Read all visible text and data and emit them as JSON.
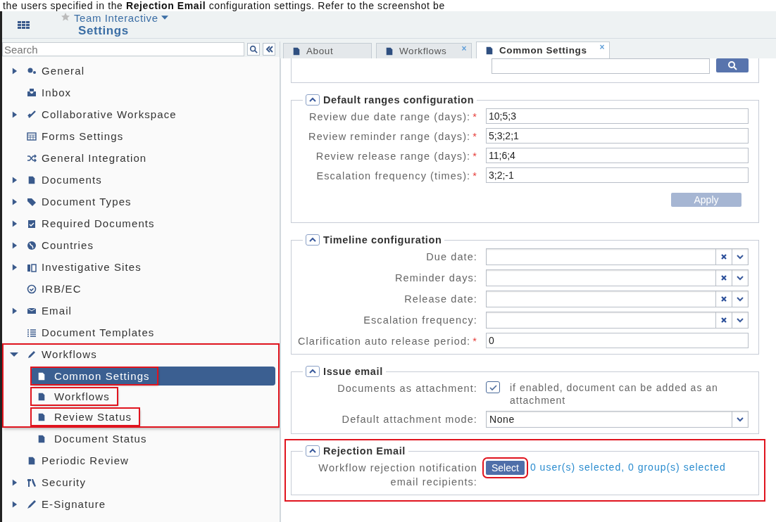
{
  "caption": "the users specified in the **Rejection Email** configuration settings. Refer to the screenshot be",
  "header": {
    "workspace": "Team Interactive",
    "title": "Settings",
    "favorite": false
  },
  "search": {
    "placeholder": "Search"
  },
  "tree": [
    {
      "label": "General",
      "expandable": true,
      "expanded": false
    },
    {
      "label": "Inbox",
      "expandable": false
    },
    {
      "label": "Collaborative Workspace",
      "expandable": true,
      "expanded": false
    },
    {
      "label": "Forms Settings",
      "expandable": false
    },
    {
      "label": "General Integration",
      "expandable": false
    },
    {
      "label": "Documents",
      "expandable": true,
      "expanded": false
    },
    {
      "label": "Document Types",
      "expandable": true,
      "expanded": false
    },
    {
      "label": "Required Documents",
      "expandable": true,
      "expanded": false
    },
    {
      "label": "Countries",
      "expandable": true,
      "expanded": false
    },
    {
      "label": "Investigative Sites",
      "expandable": true,
      "expanded": false
    },
    {
      "label": "IRB/EC",
      "expandable": false
    },
    {
      "label": "Email",
      "expandable": true,
      "expanded": false
    },
    {
      "label": "Document Templates",
      "expandable": false
    },
    {
      "label": "Workflows",
      "expandable": true,
      "expanded": true,
      "highlighted": true,
      "children": [
        {
          "label": "Common Settings",
          "selected": true,
          "highlighted": true
        },
        {
          "label": "Workflows",
          "selected": false,
          "highlighted": true
        },
        {
          "label": "Review Status",
          "selected": false,
          "highlighted": true
        },
        {
          "label": "Document Status",
          "selected": false,
          "highlighted": false
        }
      ]
    },
    {
      "label": "Periodic Review",
      "expandable": false
    },
    {
      "label": "Security",
      "expandable": true,
      "expanded": false
    },
    {
      "label": "E-Signature",
      "expandable": true,
      "expanded": false
    }
  ],
  "tabs": [
    {
      "label": "About",
      "selected": false
    },
    {
      "label": "Workflows",
      "selected": false,
      "close": "×"
    },
    {
      "label": "Common Settings",
      "selected": true,
      "close": "×"
    }
  ],
  "sections": [
    {
      "fields": [
        {
          "kind": "search"
        }
      ]
    },
    {
      "title": "Default ranges configuration",
      "expanded": true,
      "highlighted": false,
      "fields": [
        {
          "kind": "text",
          "label": "Review due date range (days):",
          "required_mark": "*",
          "value": "10;5;3"
        },
        {
          "kind": "text",
          "label": "Review reminder range (days):",
          "required_mark": "*",
          "value": "5;3;2;1"
        },
        {
          "kind": "text",
          "label": "Review release range (days):",
          "required_mark": "*",
          "value": "11;6;4"
        },
        {
          "kind": "text",
          "label": "Escalation frequency (times):",
          "required_mark": "*",
          "value": "3;2;-1"
        }
      ],
      "apply": {
        "label": "Apply",
        "disabled": true
      }
    },
    {
      "title": "Timeline configuration",
      "expanded": true,
      "highlighted": false,
      "fields": [
        {
          "kind": "combo",
          "label": "Due date:"
        },
        {
          "kind": "combo",
          "label": "Reminder days:"
        },
        {
          "kind": "combo",
          "label": "Release date:"
        },
        {
          "kind": "combo",
          "label": "Escalation frequency:"
        },
        {
          "kind": "text",
          "label": "Clarification auto release period:",
          "required_mark": "*",
          "value": "0"
        }
      ]
    },
    {
      "title": "Issue email",
      "expanded": true,
      "highlighted": false,
      "fields": [
        {
          "kind": "checkbox",
          "label": "Documents as attachment:",
          "checked": true,
          "text": "if enabled, document can be added as an attachment"
        },
        {
          "kind": "select",
          "label": "Default attachment mode:",
          "value": "None"
        }
      ]
    },
    {
      "title": "Rejection Email",
      "expanded": true,
      "highlighted": true,
      "fields": [
        {
          "kind": "recipients",
          "label": "Workflow rejection notification email recipients:",
          "button": "Select",
          "button_highlighted": true,
          "summary": "0 user(s) selected, 0 group(s) selected"
        }
      ]
    }
  ]
}
